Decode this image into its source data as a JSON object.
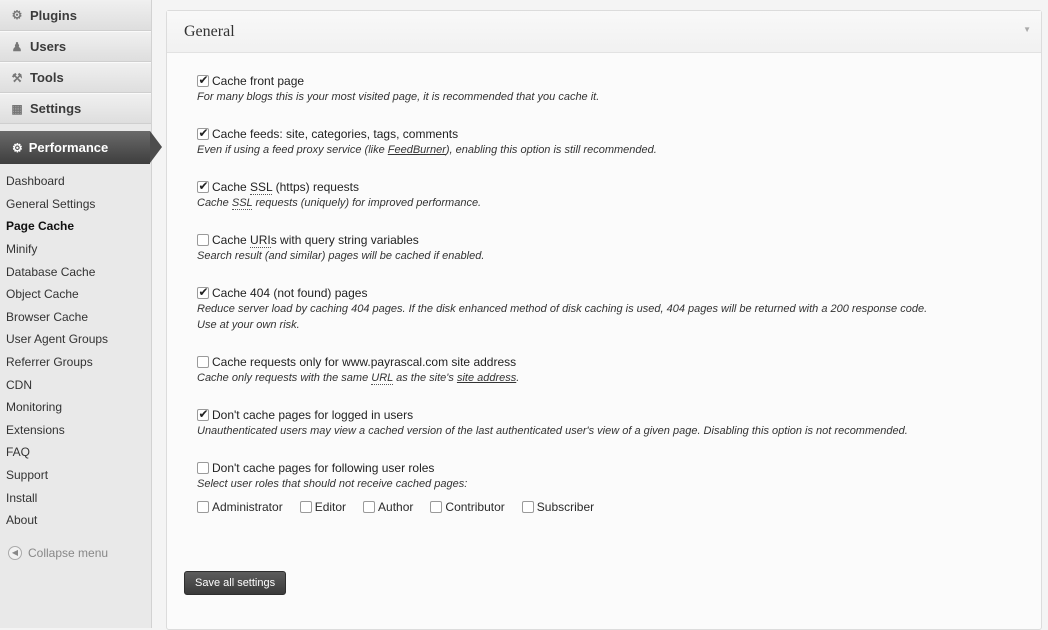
{
  "sidebar": {
    "top_items": [
      {
        "label": "Plugins",
        "icon": "plug-icon"
      },
      {
        "label": "Users",
        "icon": "users-icon"
      },
      {
        "label": "Tools",
        "icon": "tools-icon"
      },
      {
        "label": "Settings",
        "icon": "settings-icon"
      }
    ],
    "performance_label": "Performance",
    "submenu": [
      "Dashboard",
      "General Settings",
      "Page Cache",
      "Minify",
      "Database Cache",
      "Object Cache",
      "Browser Cache",
      "User Agent Groups",
      "Referrer Groups",
      "CDN",
      "Monitoring",
      "Extensions",
      "FAQ",
      "Support",
      "Install",
      "About"
    ],
    "current": "Page Cache",
    "collapse_label": "Collapse menu"
  },
  "panel": {
    "title": "General",
    "options": [
      {
        "label": "Cache front page",
        "checked": true,
        "desc": "For many blogs this is your most visited page, it is recommended that you cache it."
      },
      {
        "label": "Cache feeds: site, categories, tags, comments",
        "checked": true,
        "desc_pre": "Even if using a feed proxy service (like ",
        "desc_link": "FeedBurner",
        "desc_post": "), enabling this option is still recommended."
      },
      {
        "label_pre": "Cache ",
        "label_abbr": "SSL",
        "label_post": " (https) requests",
        "checked": true,
        "desc_pre": "Cache ",
        "desc_abbr": "SSL",
        "desc_post": " requests (uniquely) for improved performance."
      },
      {
        "label_pre": "Cache ",
        "label_abbr": "URI",
        "label_post": "s with query string variables",
        "checked": false,
        "desc": "Search result (and similar) pages will be cached if enabled."
      },
      {
        "label": "Cache 404 (not found) pages",
        "checked": true,
        "desc": "Reduce server load by caching 404 pages. If the disk enhanced method of disk caching is used, 404 pages will be returned with a 200 response code.",
        "desc2": "Use at your own risk."
      },
      {
        "label": "Cache requests only for www.payrascal.com site address",
        "checked": false,
        "desc_pre": "Cache only requests with the same ",
        "desc_abbr": "URL",
        "desc_mid": " as the site's ",
        "desc_link": "site address",
        "desc_post": "."
      },
      {
        "label": "Don't cache pages for logged in users",
        "checked": true,
        "desc": "Unauthenticated users may view a cached version of the last authenticated user's view of a given page. Disabling this option is not recommended."
      },
      {
        "label": "Don't cache pages for following user roles",
        "checked": false,
        "desc": "Select user roles that should not receive cached pages:"
      }
    ],
    "roles": [
      "Administrator",
      "Editor",
      "Author",
      "Contributor",
      "Subscriber"
    ],
    "save_label": "Save all settings"
  }
}
